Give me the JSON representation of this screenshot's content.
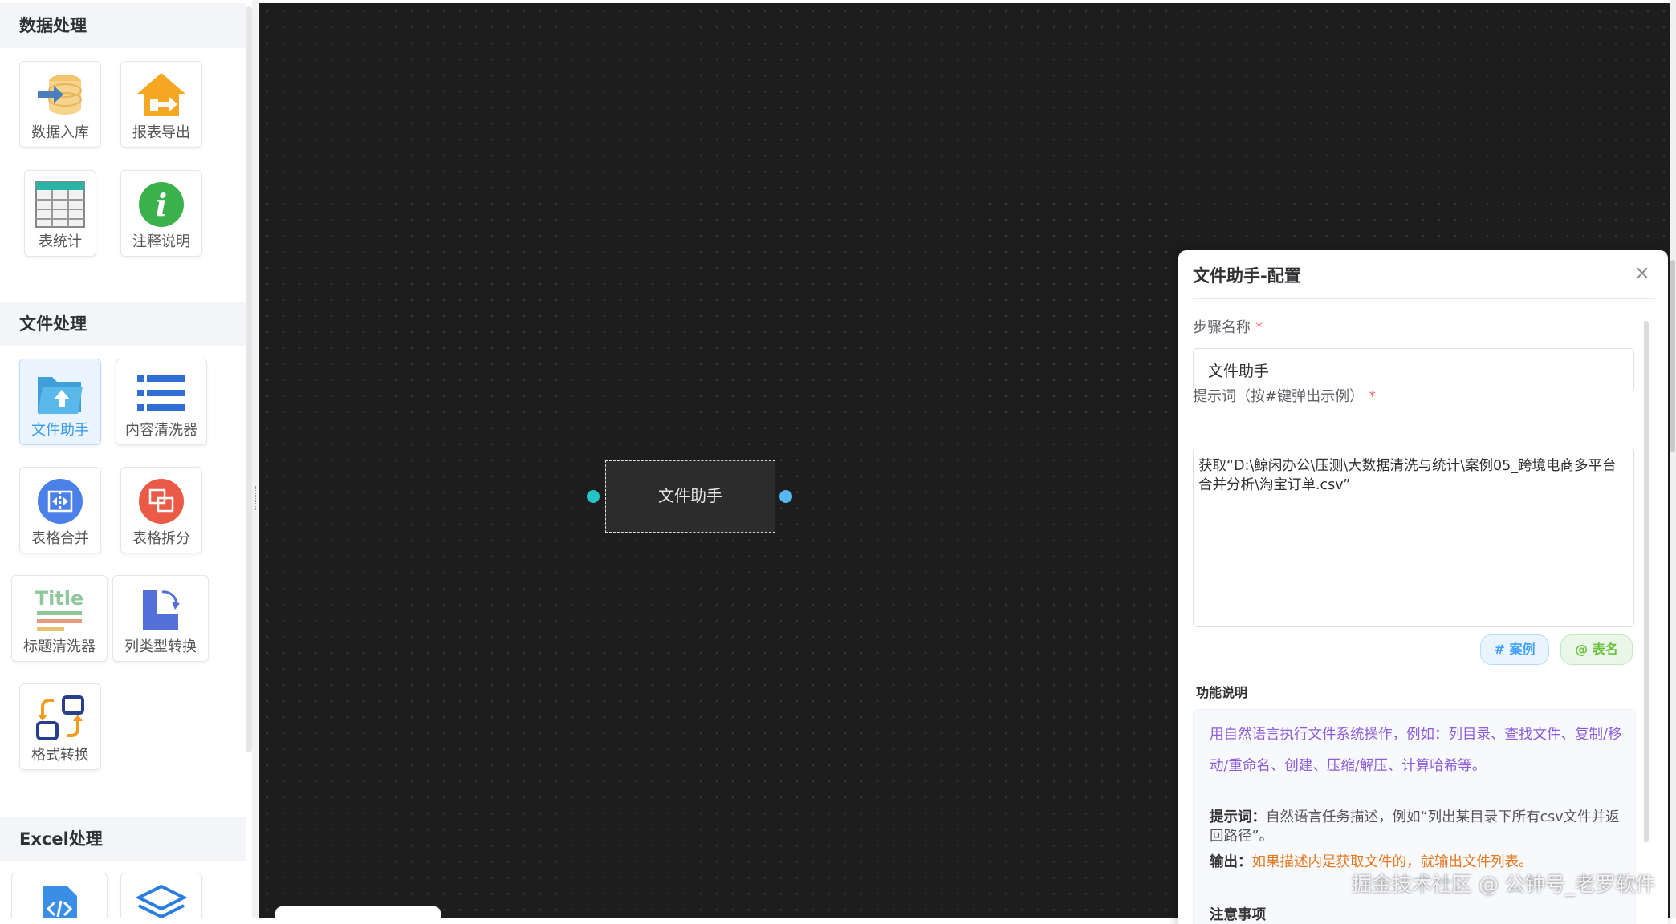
{
  "sidebar": {
    "sections": {
      "data_processing": "数据处理",
      "file_processing": "文件处理",
      "excel_processing": "Excel处理"
    },
    "tools": {
      "data_import": "数据入库",
      "report_export": "报表导出",
      "table_stats": "表统计",
      "annotation": "注释说明",
      "file_assistant": "文件助手",
      "content_cleaner": "内容清洗器",
      "table_merge": "表格合并",
      "table_split": "表格拆分",
      "title_cleaner": "标题清洗器",
      "column_type_convert": "列类型转换",
      "format_convert": "格式转换",
      "title_icon_text": "Title"
    },
    "active_tool": "文件助手"
  },
  "canvas": {
    "node_label": "文件助手"
  },
  "panel": {
    "title": "文件助手-配置",
    "close_glyph": "×",
    "step_name_label": "步骤名称",
    "required_mark": "*",
    "step_name_value": "文件助手",
    "prompt_label": "提示词（按#键弹出示例）",
    "prompt_value": "获取“D:\\鲸闲办公\\压测\\大数据清洗与统计\\案例05_跨境电商多平台合并分析\\淘宝订单.csv”",
    "case_button": "# 案例",
    "table_button": "@ 表名",
    "func_label": "功能说明",
    "desc_intro": "用自然语言执行文件系统操作，例如：列目录、查找文件、复制/移动/重命名、创建、压缩/解压、计算哈希等。",
    "desc_prompt_key": "提示词：",
    "desc_prompt_text": "自然语言任务描述，例如“列出某目录下所有csv文件并返回路径”。",
    "desc_output_key": "输出：",
    "desc_output_text": "如果描述内是获取文件的，就输出文件列表。",
    "desc_notes": "注意事项"
  },
  "watermark": "掘金技术社区 @ 公钟号_老罗软件",
  "colors": {
    "canvas_bg": "#1d1d1d",
    "accent_blue": "#409eff",
    "accent_green": "#67c23a",
    "port_in": "#23c3c6",
    "port_out": "#57b7f0",
    "desc_purple": "#8e5cd9",
    "desc_orange": "#e6781f"
  }
}
